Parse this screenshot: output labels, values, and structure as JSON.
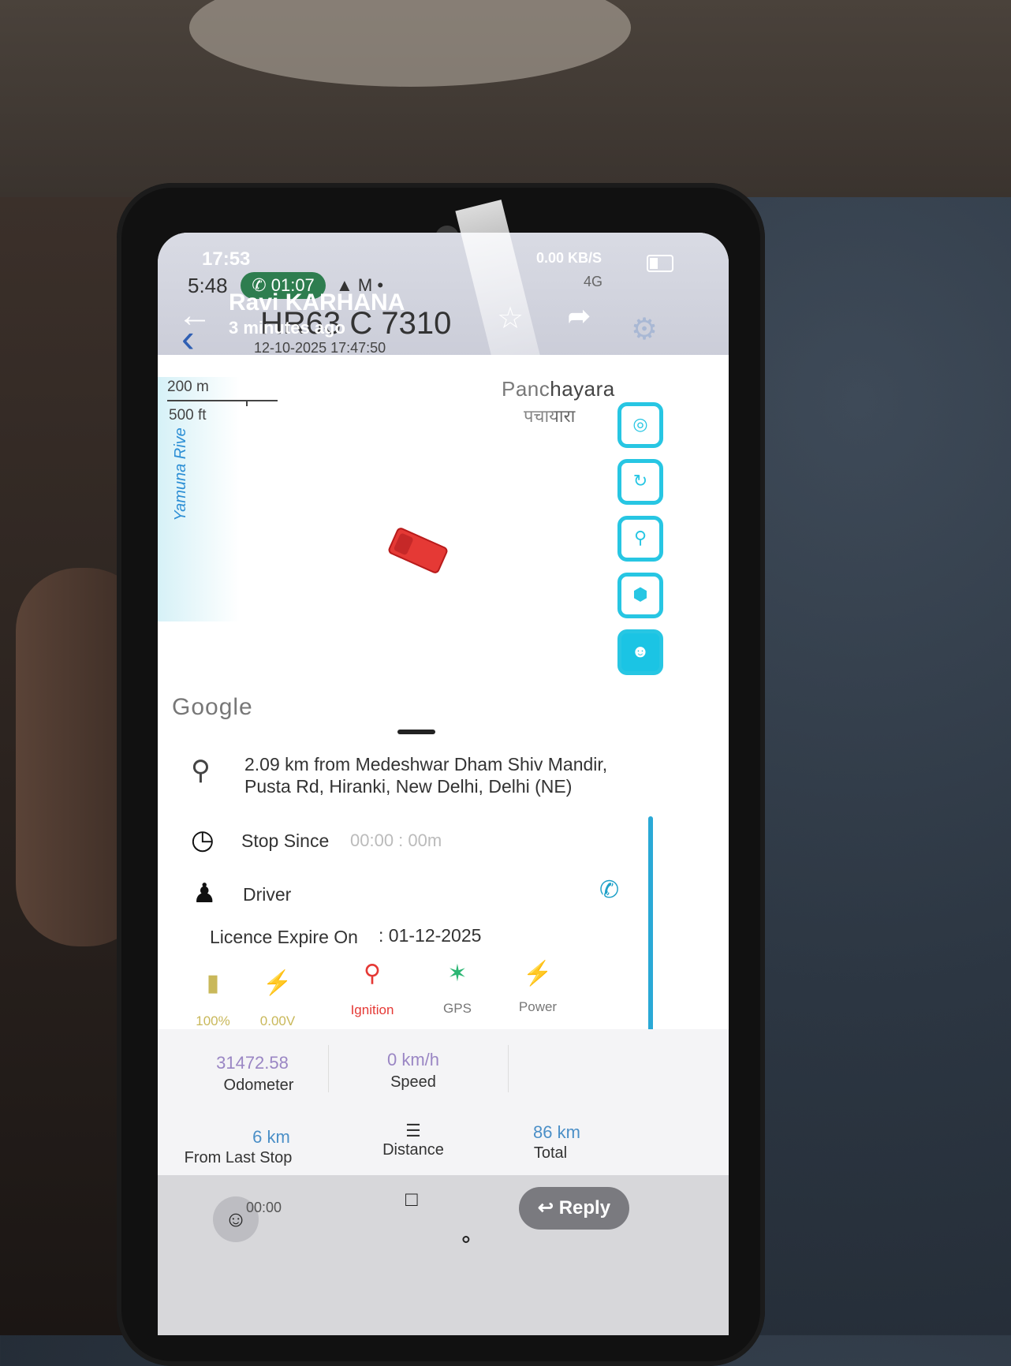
{
  "status_bar": {
    "time_overlay": "17:53",
    "time": "5:48",
    "call_timer": "01:07",
    "left_icons": "▲ M •",
    "network_speed": "0.00 KB/S",
    "signal": "4G",
    "battery_level": 0.35
  },
  "header": {
    "contact_name": "Ravi KARHANA",
    "contact_status": "3 minutes ago",
    "vehicle_number": "HR63 C 7310",
    "datetime": "12-10-2025 17:47:50"
  },
  "map": {
    "scale_metric": "200 m",
    "scale_imperial": "500 ft",
    "river_label": "Yamuna Rive",
    "place_en": "Panchayara",
    "place_hi": "पचायारा",
    "attribution": "Google",
    "buttons": [
      "locate-icon",
      "route-icon",
      "geofence-icon",
      "shield-icon",
      "driver-car-icon"
    ]
  },
  "details": {
    "address_line1": "2.09 km from Medeshwar Dham Shiv Mandir,",
    "address_line2": "Pusta Rd, Hiranki, New Delhi, Delhi (NE)",
    "stop_label": "Stop Since",
    "stop_value": "00:00 : 00m",
    "driver_label": "Driver",
    "licence_label": "Licence Expire On",
    "licence_value": ": 01-12-2025"
  },
  "status_icons": [
    {
      "name": "battery-full-icon",
      "label": "100%",
      "color": "#c9b85a"
    },
    {
      "name": "voltage-battery-icon",
      "label": "0.00V",
      "color": "#c9b85a"
    },
    {
      "name": "ignition-key-icon",
      "label": "Ignition",
      "color": "#e53935"
    },
    {
      "name": "gps-wifi-icon",
      "label": "GPS",
      "color": "#2bb673"
    },
    {
      "name": "power-battery-icon",
      "label": "Power",
      "color": "#2bb673"
    }
  ],
  "metrics": {
    "odometer_value": "31472.58",
    "odometer_label": "Odometer",
    "speed_value": "0 km/h",
    "speed_label": "Speed",
    "last_stop_value": "6 km",
    "last_stop_label": "From Last Stop",
    "distance_label": "Distance",
    "total_value": "86 km",
    "total_label": "Total"
  },
  "bottom": {
    "reply_label": "Reply",
    "partial_text": "00:00"
  },
  "colors": {
    "accent": "#1bc4e4",
    "odometer": "#9a86c4",
    "metric_blue": "#4b8fc7"
  }
}
